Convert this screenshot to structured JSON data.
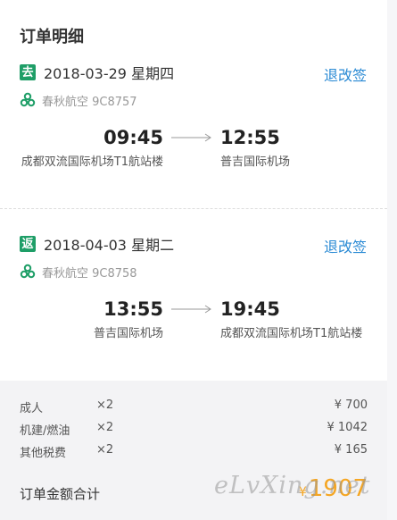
{
  "header": {
    "title": "订单明细"
  },
  "outbound": {
    "badge": "去",
    "date": "2018-03-29 星期四",
    "change_label": "退改签",
    "airline": "春秋航空 9C8757",
    "dep_time": "09:45",
    "arr_time": "12:55",
    "dep_airport": "成都双流国际机场T1航站楼",
    "arr_airport": "普吉国际机场"
  },
  "return": {
    "badge": "返",
    "date": "2018-04-03 星期二",
    "change_label": "退改签",
    "airline": "春秋航空 9C8758",
    "dep_time": "13:55",
    "arr_time": "19:45",
    "dep_airport": "普吉国际机场",
    "arr_airport": "成都双流国际机场T1航站楼"
  },
  "fees": [
    {
      "name": "成人",
      "qty": "×2",
      "price": "¥ 700"
    },
    {
      "name": "机建/燃油",
      "qty": "×2",
      "price": "¥ 1042"
    },
    {
      "name": "其他税费",
      "qty": "×2",
      "price": "¥ 165"
    }
  ],
  "total": {
    "label": "订单金额合计",
    "currency": "¥",
    "amount": "1907"
  },
  "watermark": "eLvXing.net",
  "colors": {
    "accent_green": "#1e9e67",
    "link_blue": "#2a8ad4",
    "price_orange": "#f5a623"
  },
  "icons": {
    "airline_logo": "spring-airlines-logo-icon",
    "arrow": "flight-arrow-icon"
  }
}
